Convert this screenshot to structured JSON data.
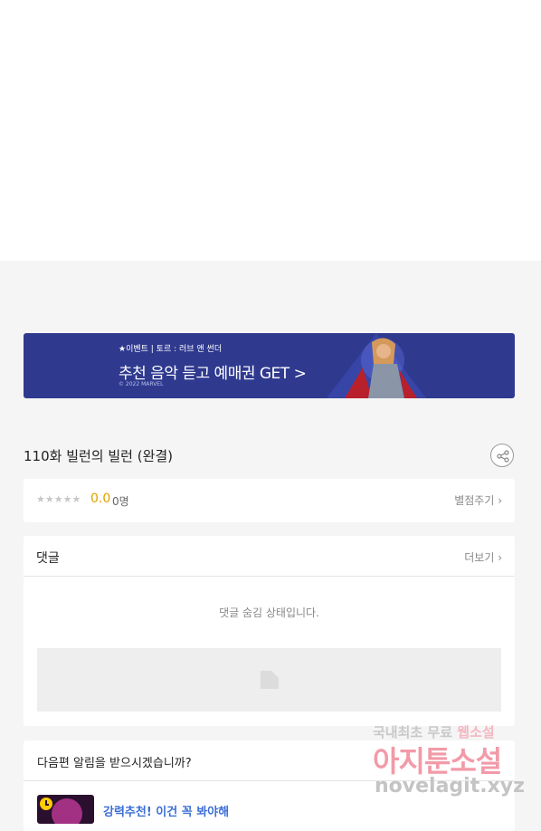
{
  "banner": {
    "kicker": "★이벤트 | 토르 : 러브 앤 썬더",
    "headline": "추천 음악 듣고 예매권 GET >",
    "copyright": "© 2022 MARVEL",
    "colors": {
      "background": "#2f3a8f"
    }
  },
  "episode": {
    "title": "110화 빌런의 빌런 (완결)",
    "share_icon": "share-icon"
  },
  "rating": {
    "stars": "★★★★★",
    "score": "0.0",
    "count": "0명",
    "rate_link": "별점주기 ›",
    "colors": {
      "score": "#e0a000"
    }
  },
  "comments": {
    "title": "댓글",
    "more_link": "더보기 ›",
    "hidden_message": "댓글 숨김 상태입니다."
  },
  "notify": {
    "title": "다음편 알림을 받으시겠습니까?",
    "recommendation": "강력추천! 이건 꼭 봐야해",
    "colors": {
      "recommendation": "#3b6fd6"
    }
  },
  "watermark": {
    "line1_a": "국내최초 무료",
    "line1_b": "웹소설",
    "line2": "아지툰소설",
    "url": "novelagit.xyz"
  }
}
